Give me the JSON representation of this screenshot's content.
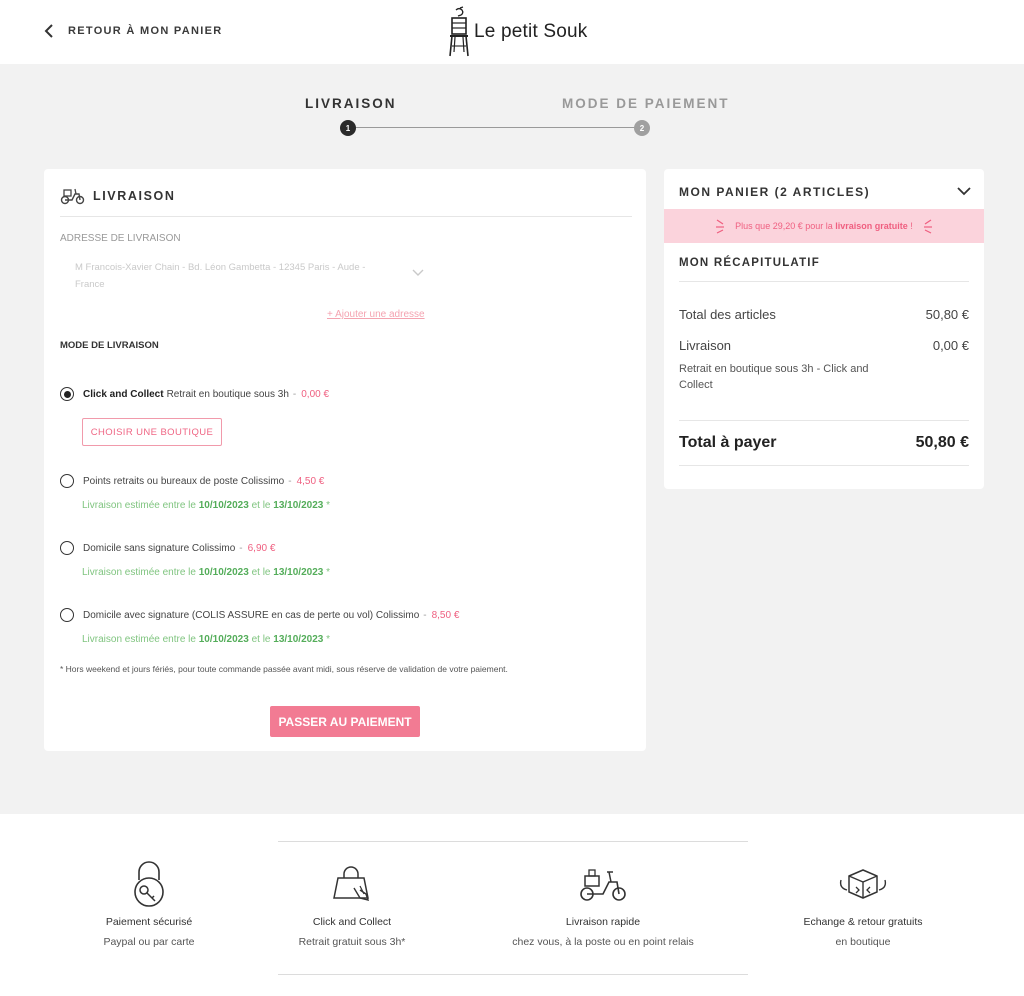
{
  "header": {
    "back_label": "RETOUR À MON PANIER",
    "logo_text": "Le petit Souk"
  },
  "stepper": {
    "steps": [
      {
        "label": "LIVRAISON",
        "number": "1",
        "active": true
      },
      {
        "label": "MODE DE PAIEMENT",
        "number": "2",
        "active": false
      }
    ]
  },
  "delivery": {
    "title": "LIVRAISON",
    "address_label": "ADRESSE DE LIVRAISON",
    "address_line1": "M Francois-Xavier Chain - Bd. Léon Gambetta - 12345 Paris - Aude -",
    "address_line2": "France",
    "add_address": "+ Ajouter une adresse",
    "mode_label": "MODE DE LIVRAISON",
    "options": [
      {
        "name": "Click and Collect",
        "desc": "Retrait en boutique sous 3h",
        "price": "0,00 €",
        "selected": true
      },
      {
        "name": "",
        "desc": "Points retraits ou bureaux de poste Colissimo",
        "price": "4,50 €",
        "selected": false
      },
      {
        "name": "",
        "desc": "Domicile sans signature Colissimo",
        "price": "6,90 €",
        "selected": false
      },
      {
        "name": "",
        "desc": "Domicile avec signature (COLIS ASSURE en cas de perte ou vol) Colissimo",
        "price": "8,50 €",
        "selected": false
      }
    ],
    "price_separator": "-",
    "choose_shop": "CHOISIR UNE BOUTIQUE",
    "estimate_prefix": "Livraison estimée entre le",
    "estimate_mid": "et le",
    "estimate_suffix": "*",
    "estimate_from": "10/10/2023",
    "estimate_to": "13/10/2023",
    "footnote": "* Hors weekend et jours fériés, pour toute commande passée avant midi, sous réserve de validation de votre paiement.",
    "pay_button": "PASSER AU PAIEMENT"
  },
  "cart": {
    "title": "MON PANIER (2 ARTICLES)",
    "promo_prefix": "Plus que 29,20 € pour la",
    "promo_bold": "livraison gratuite",
    "promo_suffix": "!",
    "recap_title": "MON RÉCAPITULATIF",
    "total_articles_label": "Total des articles",
    "total_articles_value": "50,80 €",
    "shipping_label": "Livraison",
    "shipping_value": "0,00 €",
    "shipping_detail": "Retrait en boutique sous 3h - Click and Collect",
    "total_label": "Total à payer",
    "total_value": "50,80 €"
  },
  "footer": {
    "features": [
      {
        "icon": "padlock-key-icon",
        "title": "Paiement sécurisé",
        "subtitle": "Paypal ou par carte"
      },
      {
        "icon": "shopping-bag-hand-icon",
        "title": "Click and Collect",
        "subtitle": "Retrait gratuit sous 3h*"
      },
      {
        "icon": "scooter-delivery-icon",
        "title": "Livraison rapide",
        "subtitle": "chez vous, à la poste ou en point relais"
      },
      {
        "icon": "exchange-box-icon",
        "title": "Echange & retour gratuits",
        "subtitle": "en boutique"
      }
    ]
  },
  "colors": {
    "accent_pink": "#f27b93",
    "price_pink": "#ef5f80",
    "estimate_green": "#54ad5a",
    "promo_bg": "#fbd3dc"
  }
}
